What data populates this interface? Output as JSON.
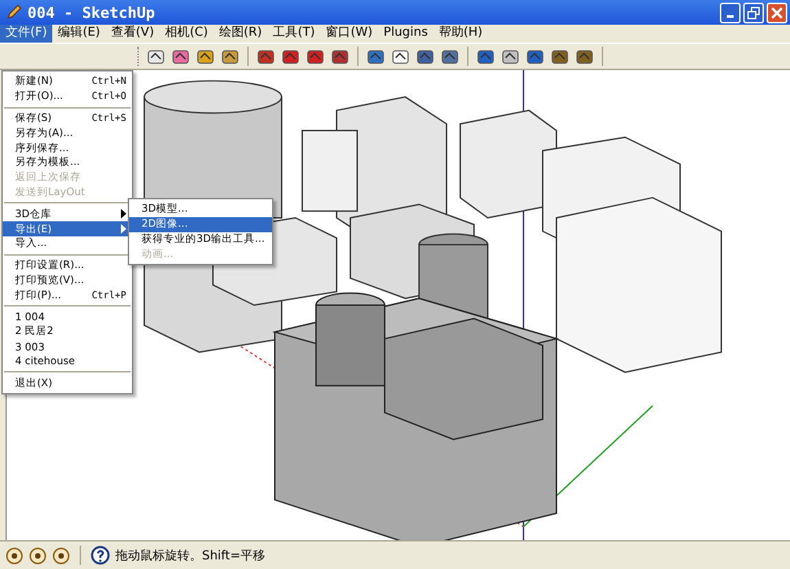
{
  "window": {
    "title": "004 - SketchUp"
  },
  "menubar": [
    {
      "label": "文件(F)",
      "selected": true
    },
    {
      "label": "编辑(E)",
      "selected": false
    },
    {
      "label": "查看(V)",
      "selected": false
    },
    {
      "label": "相机(C)",
      "selected": false
    },
    {
      "label": "绘图(R)",
      "selected": false
    },
    {
      "label": "工具(T)",
      "selected": false
    },
    {
      "label": "窗口(W)",
      "selected": false
    },
    {
      "label": "Plugins",
      "selected": false
    },
    {
      "label": "帮助(H)",
      "selected": false
    }
  ],
  "file_menu": [
    {
      "kind": "item",
      "label": "新建(N)",
      "shortcut": "Ctrl+N",
      "disabled": false,
      "selected": false,
      "submenu": false
    },
    {
      "kind": "item",
      "label": "打开(O)...",
      "shortcut": "Ctrl+O",
      "disabled": false,
      "selected": false,
      "submenu": false
    },
    {
      "kind": "separator"
    },
    {
      "kind": "item",
      "label": "保存(S)",
      "shortcut": "Ctrl+S",
      "disabled": false,
      "selected": false,
      "submenu": false
    },
    {
      "kind": "item",
      "label": "另存为(A)...",
      "disabled": false,
      "selected": false,
      "submenu": false
    },
    {
      "kind": "item",
      "label": "序列保存...",
      "disabled": false,
      "selected": false,
      "submenu": false
    },
    {
      "kind": "item",
      "label": "另存为模板...",
      "disabled": false,
      "selected": false,
      "submenu": false
    },
    {
      "kind": "item",
      "label": "返回上次保存",
      "disabled": true,
      "selected": false,
      "submenu": false
    },
    {
      "kind": "item",
      "label": "发送到LayOut",
      "disabled": true,
      "selected": false,
      "submenu": false
    },
    {
      "kind": "separator"
    },
    {
      "kind": "item",
      "label": "3D仓库",
      "disabled": false,
      "selected": false,
      "submenu": true
    },
    {
      "kind": "item",
      "label": "导出(E)",
      "disabled": false,
      "selected": true,
      "submenu": true
    },
    {
      "kind": "item",
      "label": "导入...",
      "disabled": false,
      "selected": false,
      "submenu": false
    },
    {
      "kind": "separator"
    },
    {
      "kind": "item",
      "label": "打印设置(R)...",
      "disabled": false,
      "selected": false,
      "submenu": false
    },
    {
      "kind": "item",
      "label": "打印预览(V)...",
      "disabled": false,
      "selected": false,
      "submenu": false
    },
    {
      "kind": "item",
      "label": "打印(P)...",
      "shortcut": "Ctrl+P",
      "disabled": false,
      "selected": false,
      "submenu": false
    },
    {
      "kind": "separator"
    },
    {
      "kind": "item",
      "label": "1 004",
      "disabled": false,
      "selected": false,
      "submenu": false
    },
    {
      "kind": "item",
      "label": "2 民居2",
      "disabled": false,
      "selected": false,
      "submenu": false
    },
    {
      "kind": "item",
      "label": "3 003",
      "disabled": false,
      "selected": false,
      "submenu": false
    },
    {
      "kind": "item",
      "label": "4 citehouse",
      "disabled": false,
      "selected": false,
      "submenu": false
    },
    {
      "kind": "separator"
    },
    {
      "kind": "item",
      "label": "退出(X)",
      "disabled": false,
      "selected": false,
      "submenu": false
    }
  ],
  "export_submenu": [
    {
      "label": "3D模型...",
      "disabled": false,
      "selected": false
    },
    {
      "label": "2D图像...",
      "disabled": false,
      "selected": true
    },
    {
      "label": "获得专业的3D输出工具...",
      "disabled": false,
      "selected": false
    },
    {
      "label": "动画...",
      "disabled": true,
      "selected": false
    }
  ],
  "status_bar": {
    "text": "拖动鼠标旋转。Shift=平移"
  }
}
